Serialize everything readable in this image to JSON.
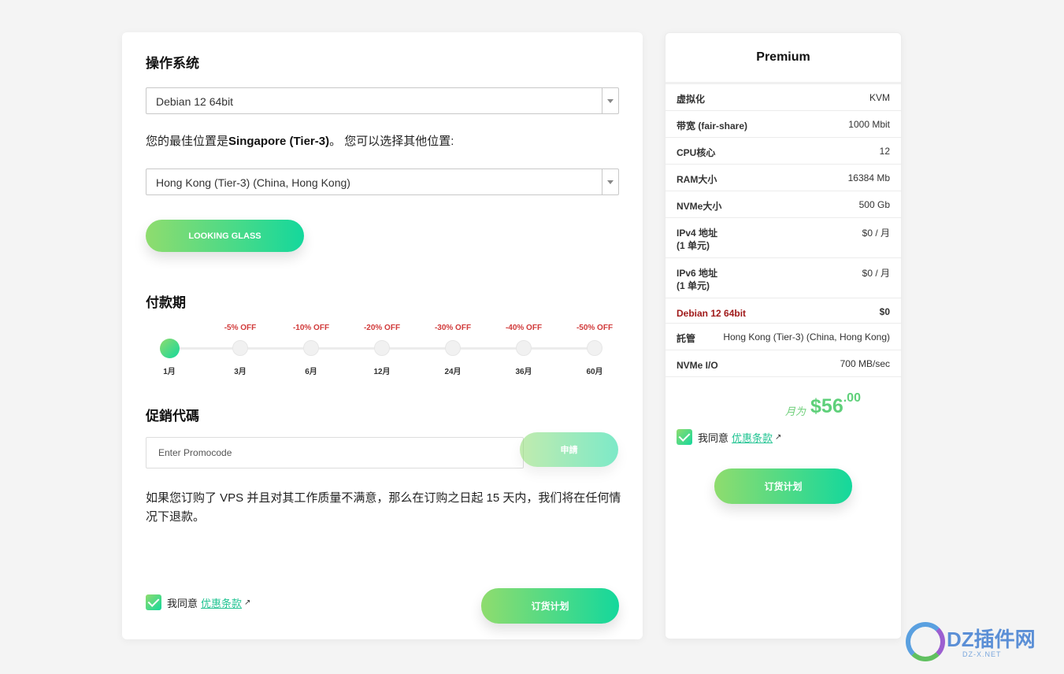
{
  "os_section": {
    "title": "操作系统",
    "selected": "Debian 12 64bit"
  },
  "location": {
    "prefix": "您的最佳位置是",
    "best": "Singapore (Tier-3)",
    "suffix": "。 您可以选择其他位置:",
    "selected": "Hong Kong (Tier-3) (China, Hong Kong)"
  },
  "looking_glass_label": "LOOKING GLASS",
  "billing": {
    "title": "付款期",
    "periods": [
      {
        "label": "1月",
        "off": "",
        "active": true
      },
      {
        "label": "3月",
        "off": "-5% OFF"
      },
      {
        "label": "6月",
        "off": "-10% OFF"
      },
      {
        "label": "12月",
        "off": "-20% OFF"
      },
      {
        "label": "24月",
        "off": "-30% OFF"
      },
      {
        "label": "36月",
        "off": "-40% OFF"
      },
      {
        "label": "60月",
        "off": "-50% OFF"
      }
    ]
  },
  "promo": {
    "title": "促銷代碼",
    "placeholder": "Enter Promocode",
    "apply_label": "申請"
  },
  "refund_text": "如果您订购了 VPS 并且对其工作质量不满意，那么在订购之日起 15 天内，我们将在任何情况下退款。",
  "agree": {
    "text": "我同意",
    "link": "优惠条款"
  },
  "order_label": "订货计划",
  "plan": {
    "title": "Premium",
    "specs": [
      {
        "k": "虚拟化",
        "v": "KVM"
      },
      {
        "k": "带宽 (fair-share)",
        "v": "1000 Mbit"
      },
      {
        "k": "CPU核心",
        "v": "12"
      },
      {
        "k": "RAM大小",
        "v": "16384 Mb"
      },
      {
        "k": "NVMe大小",
        "v": "500 Gb"
      },
      {
        "k": "IPv4 地址",
        "k2": "(1 单元)",
        "v": "$0 / 月"
      },
      {
        "k": "IPv6 地址",
        "k2": "(1 单元)",
        "v": "$0 / 月"
      },
      {
        "k": "Debian 12 64bit",
        "v": "$0",
        "red": true
      },
      {
        "k": "託管",
        "v": "Hong Kong (Tier-3) (China, Hong Kong)"
      },
      {
        "k": "NVMe I/O",
        "v": "700 MB/sec"
      }
    ],
    "price_per": "月为",
    "price_amount": "$56",
    "price_cents": ".00"
  },
  "watermark": {
    "text": "DZ插件网",
    "sub": "DZ-X.NET"
  }
}
